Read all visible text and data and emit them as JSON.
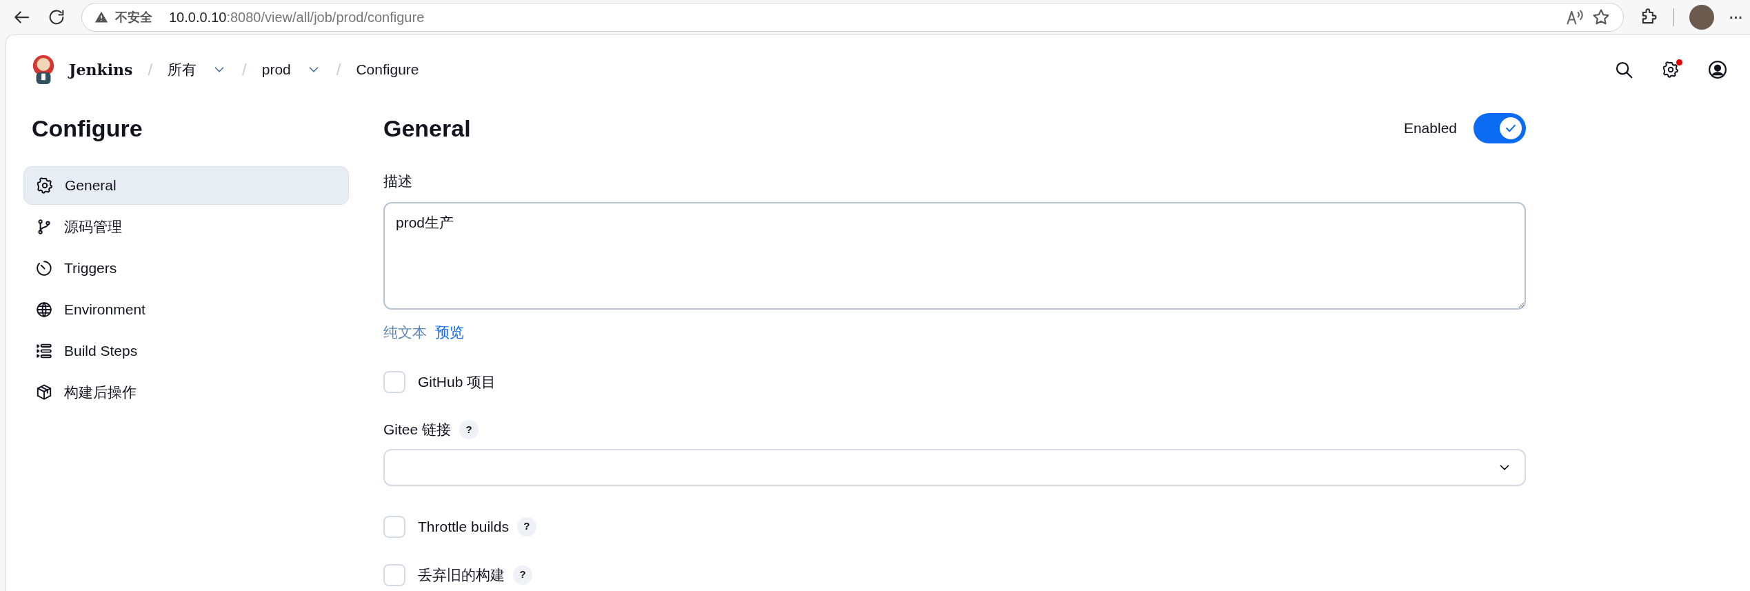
{
  "browser": {
    "security": "不安全",
    "url_host": "10.0.0.10",
    "url_path": ":8080/view/all/job/prod/configure",
    "more": "···"
  },
  "header": {
    "brand": "Jenkins",
    "breadcrumbs": [
      {
        "separator": "/",
        "label": "所有",
        "dropdown": true
      },
      {
        "separator": "/",
        "label": "prod",
        "dropdown": true
      },
      {
        "separator": "/",
        "label": "Configure",
        "dropdown": false
      }
    ],
    "settings_alert": true
  },
  "sidebar": {
    "title": "Configure",
    "items": [
      {
        "label": "General",
        "selected": true
      },
      {
        "label": "源码管理",
        "selected": false
      },
      {
        "label": "Triggers",
        "selected": false
      },
      {
        "label": "Environment",
        "selected": false
      },
      {
        "label": "Build Steps",
        "selected": false
      },
      {
        "label": "构建后操作",
        "selected": false
      }
    ]
  },
  "main": {
    "title": "General",
    "enabled": {
      "label": "Enabled",
      "on": true
    },
    "description": {
      "label": "描述",
      "value": "prod生产",
      "plain_text": "纯文本",
      "preview": "预览"
    },
    "options": [
      {
        "kind": "checkbox",
        "label": "GitHub 项目",
        "checked": false
      },
      {
        "kind": "select",
        "label": "Gitee 链接",
        "help": "?"
      },
      {
        "kind": "checkbox",
        "label": "Throttle builds",
        "checked": false,
        "help": "?"
      },
      {
        "kind": "checkbox",
        "label": "丢弃旧的构建",
        "checked": false,
        "help": "?"
      }
    ]
  }
}
